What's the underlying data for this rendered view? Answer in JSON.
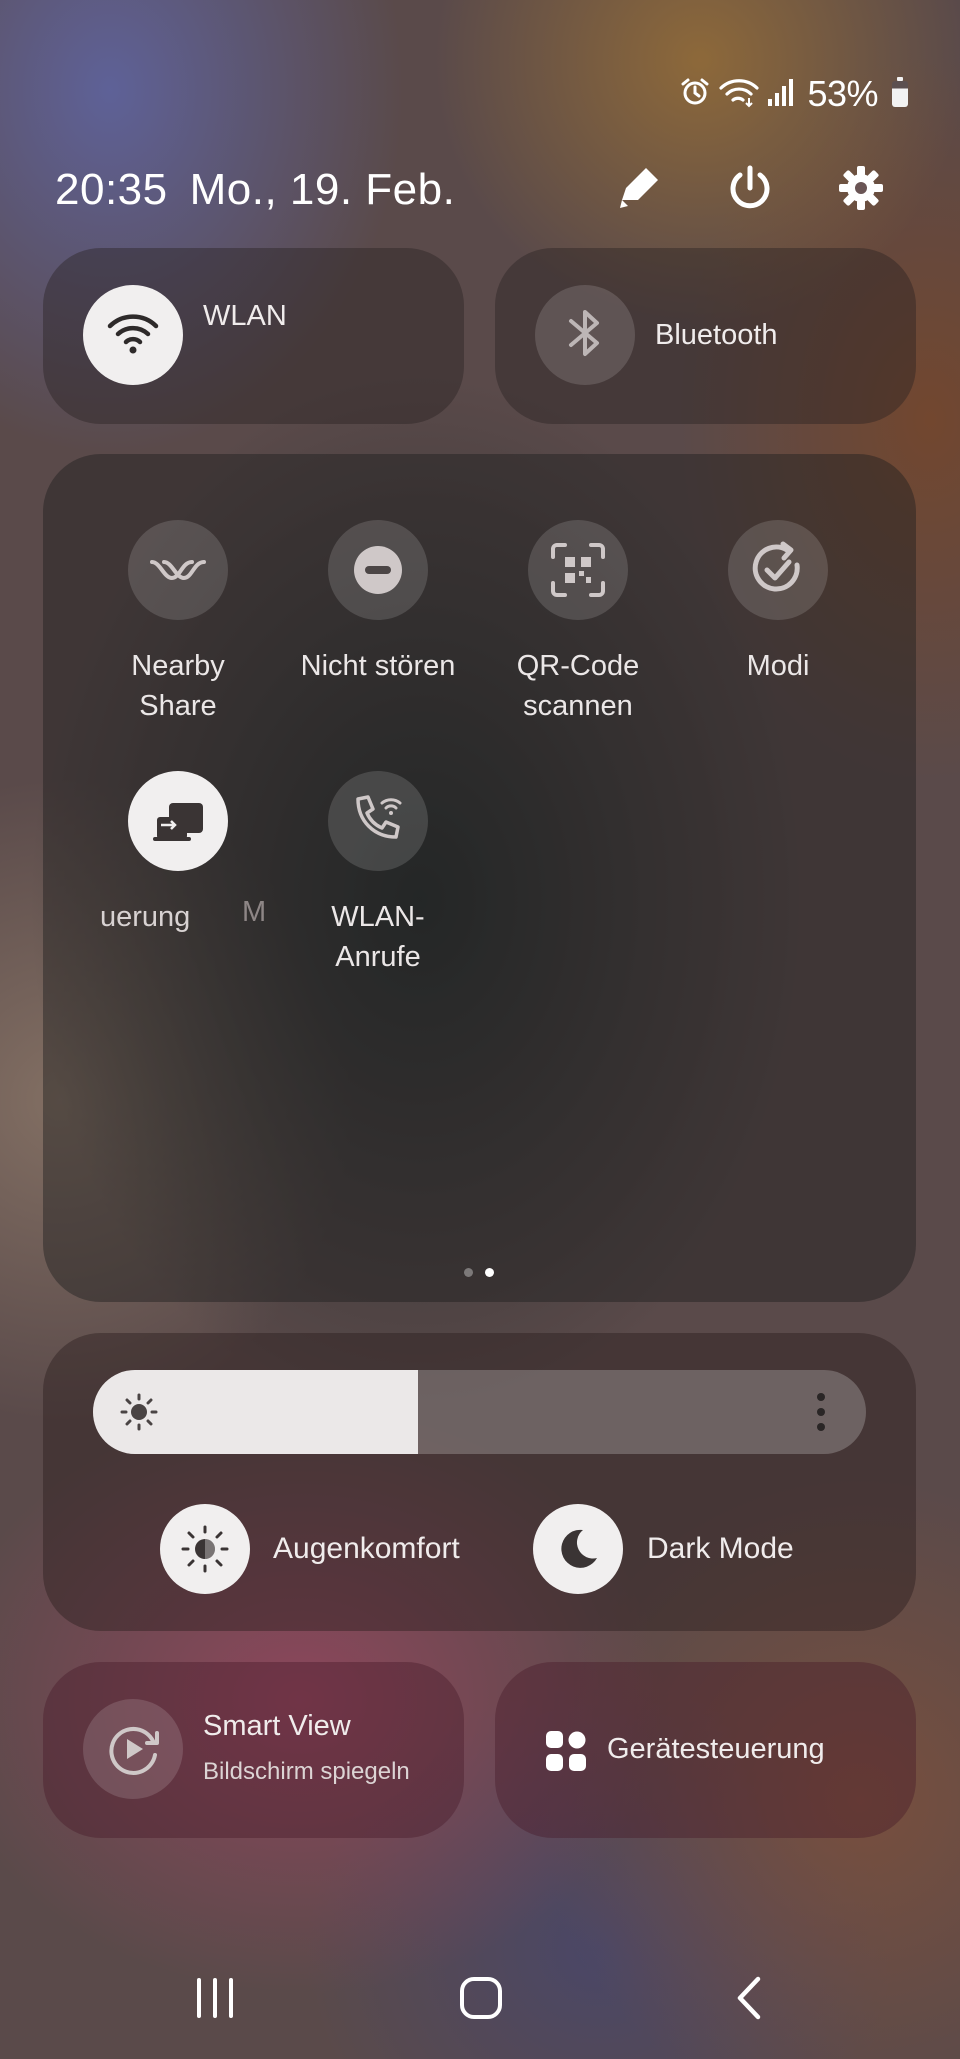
{
  "status_bar": {
    "battery": "53%",
    "icons": [
      "alarm-icon",
      "wifi-icon",
      "signal-icon",
      "battery-icon"
    ]
  },
  "header": {
    "time": "20:35",
    "date": "Mo., 19. Feb.",
    "icons": [
      "pencil-icon",
      "power-icon",
      "gear-icon"
    ]
  },
  "big_tiles": {
    "wlan": "WLAN",
    "bluetooth": "Bluetooth"
  },
  "quick_settings": {
    "nearby": "Nearby\nShare",
    "dnd": "Nicht stören",
    "qr": "QR-Code\nscannen",
    "modi": "Modi",
    "device_control_partial": "uerung",
    "partial_m": "M",
    "wifi_calling": "WLAN-\nAnrufe"
  },
  "page_indicator": {
    "pages": 2,
    "active": 2
  },
  "brightness": {
    "level_percent": 42,
    "eye_comfort": "Augenkomfort",
    "dark_mode": "Dark Mode"
  },
  "bottom_tiles": {
    "smart_view_title": "Smart View",
    "smart_view_subtitle": "Bildschirm spiegeln",
    "device_control": "Gerätesteuerung"
  },
  "colors": {
    "active_circle": "#f1efef",
    "inactive_circle": "rgba(255,255,255,0.14)"
  }
}
